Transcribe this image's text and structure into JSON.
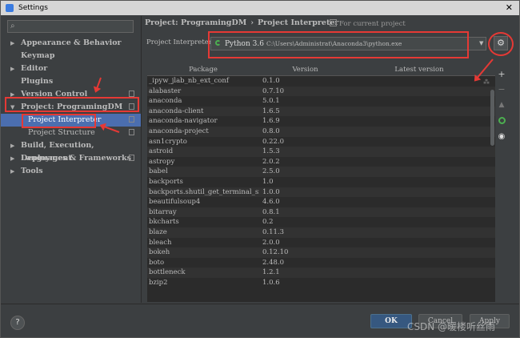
{
  "window": {
    "title": "Settings",
    "close_glyph": "✕"
  },
  "search": {
    "placeholder": ""
  },
  "sidebar": {
    "items": [
      {
        "label": "Appearance & Behavior",
        "arrow": "▶"
      },
      {
        "label": "Keymap",
        "arrow": ""
      },
      {
        "label": "Editor",
        "arrow": "▶"
      },
      {
        "label": "Plugins",
        "arrow": ""
      },
      {
        "label": "Version Control",
        "arrow": "▶"
      },
      {
        "label": "Project: ProgramingDM",
        "arrow": "▼"
      },
      {
        "label": "Project Interpreter",
        "arrow": ""
      },
      {
        "label": "Project Structure",
        "arrow": ""
      },
      {
        "label": "Build, Execution, Deployment",
        "arrow": "▶"
      },
      {
        "label": "Languages & Frameworks",
        "arrow": "▶"
      },
      {
        "label": "Tools",
        "arrow": "▶"
      }
    ]
  },
  "breadcrumb": {
    "project": "Project: ProgramingDM",
    "separator": "›",
    "page": "Project Interpreter"
  },
  "for_project": "For current project",
  "interpreter": {
    "label": "Project Interpreter:",
    "version": "Python 3.6",
    "path": "C:\\Users\\Administrat\\Anaconda3\\python.exe"
  },
  "icons": {
    "dropdown": "▼",
    "gear": "⚙",
    "plus": "+",
    "minus": "−",
    "up": "▲",
    "eye": "◉",
    "spinner": "⁂",
    "search": "⌕",
    "help": "?"
  },
  "table": {
    "columns": [
      "Package",
      "Version",
      "Latest version"
    ],
    "rows": [
      {
        "pkg": "_ipyw_jlab_nb_ext_conf",
        "ver": "0.1.0"
      },
      {
        "pkg": "alabaster",
        "ver": "0.7.10"
      },
      {
        "pkg": "anaconda",
        "ver": "5.0.1"
      },
      {
        "pkg": "anaconda-client",
        "ver": "1.6.5"
      },
      {
        "pkg": "anaconda-navigator",
        "ver": "1.6.9"
      },
      {
        "pkg": "anaconda-project",
        "ver": "0.8.0"
      },
      {
        "pkg": "asn1crypto",
        "ver": "0.22.0"
      },
      {
        "pkg": "astroid",
        "ver": "1.5.3"
      },
      {
        "pkg": "astropy",
        "ver": "2.0.2"
      },
      {
        "pkg": "babel",
        "ver": "2.5.0"
      },
      {
        "pkg": "backports",
        "ver": "1.0"
      },
      {
        "pkg": "backports.shutil_get_terminal_si...",
        "ver": "1.0.0"
      },
      {
        "pkg": "beautifulsoup4",
        "ver": "4.6.0"
      },
      {
        "pkg": "bitarray",
        "ver": "0.8.1"
      },
      {
        "pkg": "bkcharts",
        "ver": "0.2"
      },
      {
        "pkg": "blaze",
        "ver": "0.11.3"
      },
      {
        "pkg": "bleach",
        "ver": "2.0.0"
      },
      {
        "pkg": "bokeh",
        "ver": "0.12.10"
      },
      {
        "pkg": "boto",
        "ver": "2.48.0"
      },
      {
        "pkg": "bottleneck",
        "ver": "1.2.1"
      },
      {
        "pkg": "bzip2",
        "ver": "1.0.6"
      }
    ]
  },
  "buttons": {
    "ok": "OK",
    "cancel": "Cancel",
    "apply": "Apply"
  },
  "watermark": "CSDN @暖楼听丝雨",
  "colors": {
    "accent_selection": "#4b6eaf",
    "annotation_red": "#e53935",
    "ok_button": "#365880"
  }
}
